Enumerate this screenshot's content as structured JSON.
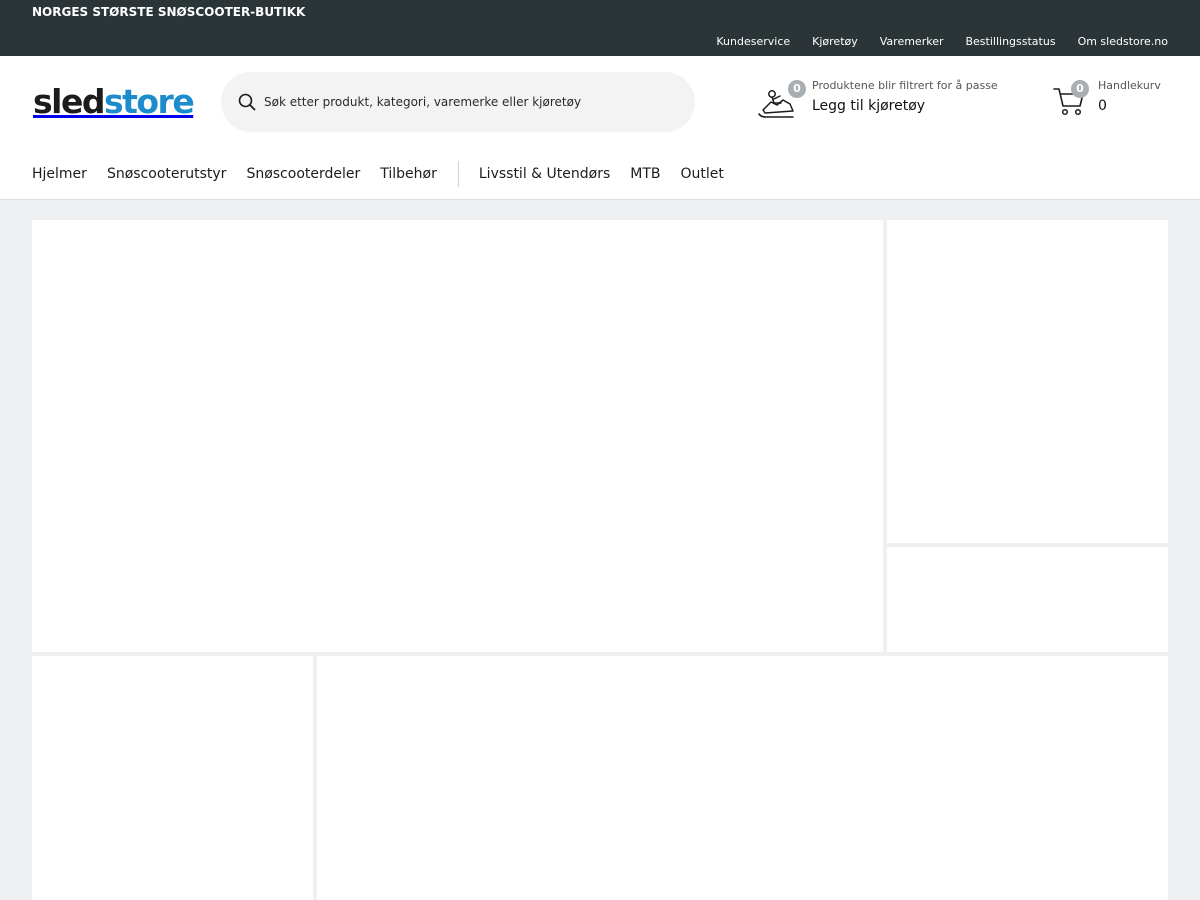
{
  "topbar": {
    "tagline": "NORGES STØRSTE SNØSCOOTER-BUTIKK",
    "links": [
      "Kundeservice",
      "Kjøretøy",
      "Varemerker",
      "Bestillingsstatus",
      "Om sledstore.no"
    ]
  },
  "header": {
    "logo": {
      "part1": "sled",
      "part2": "store"
    },
    "search": {
      "placeholder": "Søk etter produkt, kategori, varemerke eller kjøretøy",
      "icon": "search-icon"
    },
    "vehicle": {
      "count": "0",
      "subtitle": "Produktene blir filtrert for å passe",
      "action": "Legg til kjøretøy",
      "icon": "snowmobile-icon"
    },
    "cart": {
      "count": "0",
      "label": "Handlekurv",
      "total": "0",
      "icon": "cart-icon"
    }
  },
  "nav": {
    "primary": [
      "Hjelmer",
      "Snøscooterutstyr",
      "Snøscooterdeler",
      "Tilbehør"
    ],
    "secondary": [
      "Livsstil & Utendørs",
      "MTB",
      "Outlet"
    ]
  },
  "colors": {
    "topbar": "#2b3538",
    "brand_blue": "#1d8ccc",
    "page_bg": "#eff0f2",
    "badge": "#a9aeb2"
  }
}
